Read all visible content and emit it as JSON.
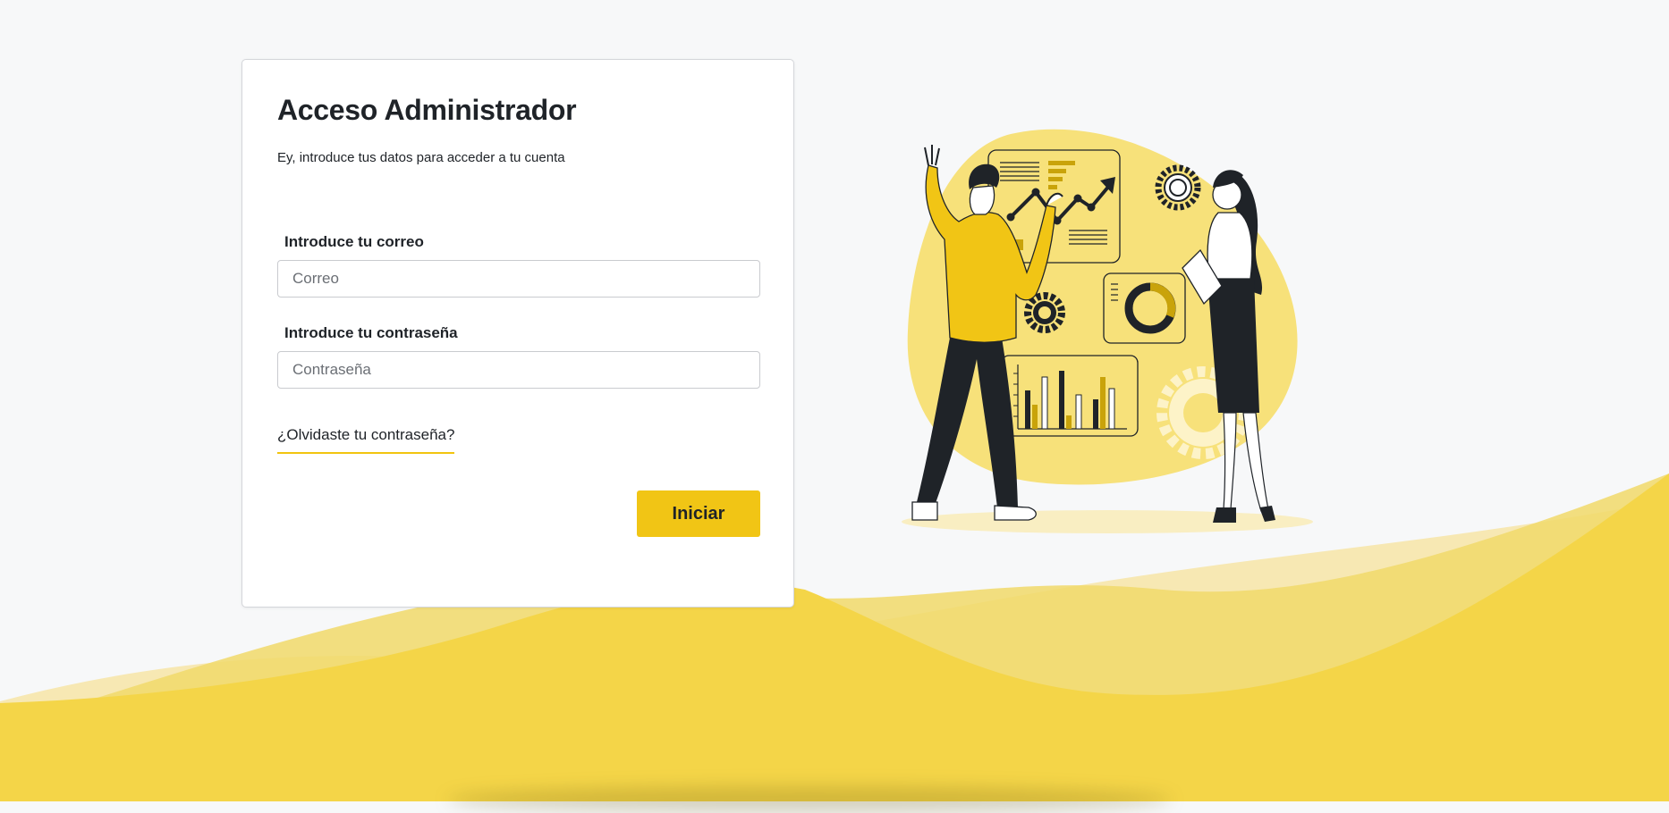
{
  "login": {
    "title": "Acceso Administrador",
    "subtitle": "Ey, introduce tus datos para acceder a tu cuenta",
    "email_label": "Introduce tu correo",
    "email_placeholder": "Correo",
    "email_value": "",
    "password_label": "Introduce tu contraseña",
    "password_placeholder": "Contraseña",
    "password_value": "",
    "forgot_link": "¿Olvidaste tu contraseña?",
    "submit_label": "Iniciar"
  },
  "theme": {
    "accent": "#f1c515",
    "wave_light": "#f7e8b3",
    "wave_mid": "#f3d55a",
    "wave_main": "#f4d548",
    "background": "#f7f8f9",
    "ink": "#1f2328"
  },
  "illustration": {
    "icon": "business-team-analytics-illustration"
  }
}
